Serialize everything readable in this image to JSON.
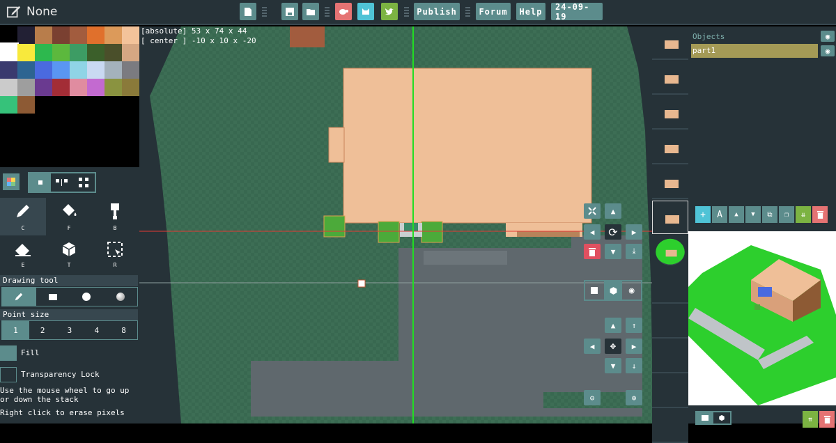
{
  "header": {
    "title": "None",
    "buttons": {
      "publish": "Publish",
      "forum": "Forum",
      "help": "Help",
      "version": "24-09-19"
    }
  },
  "palette": [
    "#000000",
    "#222034",
    "#b87d4b",
    "#7a4031",
    "#a25c3e",
    "#e0702c",
    "#dc9a5a",
    "#f3c39a",
    "#ffffff",
    "#f8e93c",
    "#2db84e",
    "#5cb83d",
    "#3d9c64",
    "#3b5f2a",
    "#4a4f2a",
    "#d5a783",
    "#3a3a6e",
    "#2d6491",
    "#4a6adf",
    "#5a96f2",
    "#8fd4e6",
    "#c9d9f2",
    "#a4b2bc",
    "#7b7b80",
    "#cbcbcb",
    "#9e9e9e",
    "#6a3a90",
    "#a32d36",
    "#e08ca0",
    "#c36ad0",
    "#8a9340",
    "#8a7a3a",
    "#36c27a",
    "#8d5a34"
  ],
  "left": {
    "tools": [
      {
        "key": "C",
        "icon": "pencil-icon"
      },
      {
        "key": "F",
        "icon": "paint-bucket-icon"
      },
      {
        "key": "B",
        "icon": "brush-icon"
      },
      {
        "key": "E",
        "icon": "eraser-icon"
      },
      {
        "key": "T",
        "icon": "cube-icon"
      },
      {
        "key": "R",
        "icon": "select-icon"
      }
    ],
    "drawing_tool_title": "Drawing tool",
    "point_size_title": "Point size",
    "point_sizes": [
      "1",
      "2",
      "3",
      "4",
      "8"
    ],
    "fill_label": "Fill",
    "transparency_lock_label": "Transparency Lock",
    "note1": "Use the mouse wheel to go up or down the stack",
    "note2": "Right click to erase pixels"
  },
  "canvas": {
    "hud_line1": "[absolute] 53 x 74 x 44",
    "hud_line2": "[ center ] -10 x 10 x -20",
    "colors": {
      "ground": "#3a6b52",
      "grass_dark": "#2f5c45",
      "roof": "#efbf98",
      "path": "#5f686d",
      "green": "#4caa3a"
    }
  },
  "right": {
    "objects_label": "Objects",
    "object_name": "part1"
  }
}
